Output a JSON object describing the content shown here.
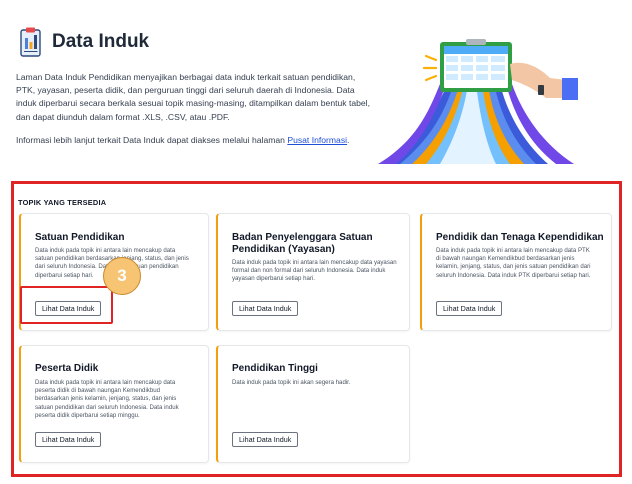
{
  "header": {
    "title": "Data Induk",
    "description": "Laman Data Induk Pendidikan menyajikan berbagai data induk terkait satuan pendidikan, PTK, yayasan, peserta didik, dan perguruan tinggi dari seluruh daerah di Indonesia. Data induk diperbarui secara berkala sesuai topik masing-masing, ditampilkan dalam bentuk tabel, dan dapat diunduh dalam format .XLS, .CSV, atau .PDF.",
    "more_info_text": "Informasi lebih lanjut terkait Data Induk dapat diakses melalui halaman",
    "more_info_link": "Pusat Informasi",
    "more_info_end": "."
  },
  "topics": {
    "label": "TOPIK YANG TERSEDIA",
    "cards": [
      {
        "title": "Satuan Pendidikan",
        "desc": "Data induk pada topik ini antara lain mencakup data satuan pendidikan berdasarkan jenjang, status, dan jenis dari seluruh Indonesia. Data induk satuan pendidikan diperbarui setiap hari.",
        "button": "Lihat Data Induk"
      },
      {
        "title": "Badan Penyelenggara Satuan Pendidikan (Yayasan)",
        "desc": "Data induk pada topik ini antara lain mencakup data yayasan formal dan non formal dari seluruh Indonesia. Data induk yayasan diperbarui setiap hari.",
        "button": "Lihat Data Induk"
      },
      {
        "title": "Pendidik dan Tenaga Kependidikan",
        "desc": "Data induk pada topik ini antara lain mencakup data PTK di bawah naungan Kemendikbud berdasarkan jenis kelamin, jenjang, status, dan jenis satuan pendidikan dari seluruh Indonesia. Data induk PTK diperbarui setiap hari.",
        "button": "Lihat Data Induk"
      },
      {
        "title": "Peserta Didik",
        "desc": "Data induk pada topik ini antara lain mencakup data peserta didik di bawah naungan Kemendikbud berdasarkan jenis kelamin, jenjang, status, dan jenis satuan pendidikan dari seluruh Indonesia. Data induk peserta didik diperbarui setiap minggu.",
        "button": "Lihat Data Induk"
      },
      {
        "title": "Pendidikan Tinggi",
        "desc": "Data induk pada topik ini akan segera hadir.",
        "button": "Lihat Data Induk"
      }
    ]
  },
  "annotation": {
    "step": "3"
  },
  "colors": {
    "accent": "#f59e0b",
    "highlight": "#e02424",
    "link": "#1d4ed8",
    "badge": "#f6c473"
  },
  "icons": [
    "document-chart-icon",
    "data-dashboard-illustration"
  ]
}
